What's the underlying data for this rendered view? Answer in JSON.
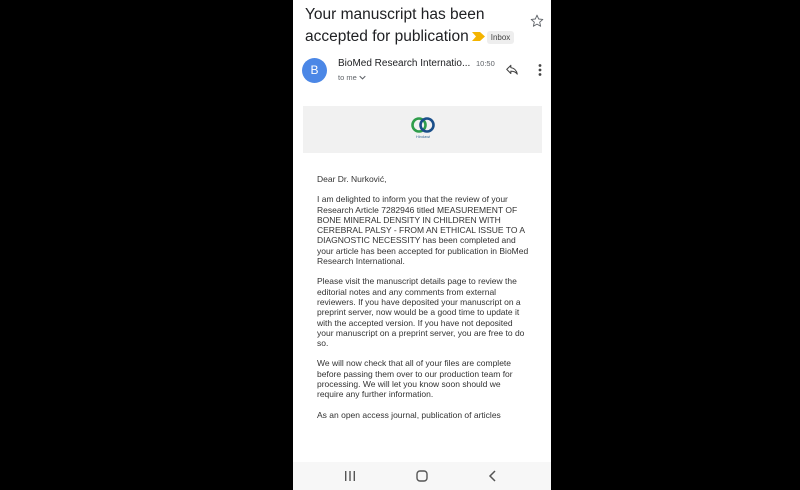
{
  "email": {
    "subject": "Your manuscript has been accepted for publication",
    "label": "Inbox",
    "sender": {
      "avatar_letter": "B",
      "name": "BioMed Research Internatio...",
      "time": "10:50",
      "to": "to me"
    },
    "banner": {
      "logo_text": "Hindawi"
    },
    "body": {
      "greeting": "Dear Dr. Nurković,",
      "p1": "I am delighted to inform you that the review of your Research Article 7282946 titled MEASUREMENT OF BONE MINERAL DENSITY IN CHILDREN WITH CEREBRAL PALSY - FROM AN ETHICAL ISSUE TO A DIAGNOSTIC NECESSITY has been completed and your article has been accepted for publication in BioMed Research International.",
      "p2": "Please visit the manuscript details page to review the editorial notes and any comments from external reviewers. If you have deposited your manuscript on a preprint server, now would be a good time to update it with the accepted version. If you have not deposited your manuscript on a preprint server, you are free to do so.",
      "p3": "We will now check that all of your files are complete before passing them over to our production team for processing. We will let you know soon should we require any further information.",
      "p4": "As an open access journal, publication of articles"
    }
  },
  "icons": {
    "important": "important-marker-icon",
    "star": "star-icon",
    "reply": "reply-icon",
    "more": "more-vert-icon",
    "chevron": "chevron-down-icon",
    "recents": "recents-icon",
    "home": "home-icon",
    "back": "back-icon"
  },
  "colors": {
    "avatar": "#4b87e6",
    "important": "#f4b400",
    "logo_green": "#2e9d4a",
    "logo_blue": "#1a4f8a"
  }
}
